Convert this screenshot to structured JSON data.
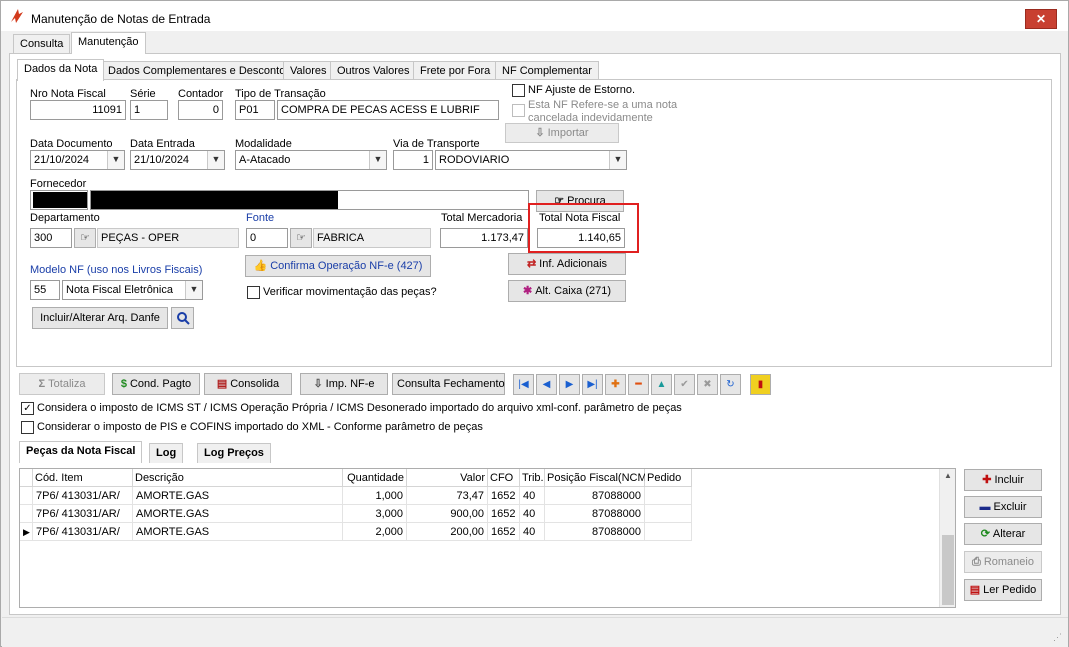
{
  "window": {
    "title": "Manutenção de Notas de Entrada",
    "close": "✕"
  },
  "main_tabs": [
    {
      "label": "Consulta"
    },
    {
      "label": "Manutenção"
    }
  ],
  "sub_tabs": [
    {
      "label": "Dados da Nota"
    },
    {
      "label": "Dados Complementares e Desconto"
    },
    {
      "label": "Valores"
    },
    {
      "label": "Outros Valores"
    },
    {
      "label": "Frete por Fora"
    },
    {
      "label": "NF Complementar"
    }
  ],
  "form": {
    "nro_nota_label": "Nro Nota Fiscal",
    "nro_nota": "11091",
    "serie_label": "Série",
    "serie": "1",
    "contador_label": "Contador",
    "contador": "0",
    "tipo_label": "Tipo de Transação",
    "tipo_code": "P01",
    "tipo_desc": "COMPRA DE PECAS ACESS E LUBRIF",
    "ajuste_label": "NF Ajuste  de Estorno.",
    "refere_label1": "Esta NF Refere-se a uma nota",
    "refere_label2": "cancelada indevidamente",
    "importar_label": "Importar",
    "data_doc_label": "Data Documento",
    "data_doc": "21/10/2024",
    "data_ent_label": "Data Entrada",
    "data_ent": "21/10/2024",
    "modalidade_label": "Modalidade",
    "modalidade": "A-Atacado",
    "via_label": "Via de Transporte",
    "via_code": "1",
    "via_desc": "RODOVIARIO",
    "fornecedor_label": "Fornecedor",
    "procura_label": "Procura",
    "depto_label": "Departamento",
    "depto_code": "300",
    "depto_desc": "PEÇAS - OPER",
    "fonte_label": "Fonte",
    "fonte_code": "0",
    "fonte_desc": "FABRICA",
    "total_merc_label": "Total Mercadoria",
    "total_merc": "1.173,47",
    "total_nf_label": "Total Nota Fiscal",
    "total_nf": "1.140,65",
    "modelo_label": "Modelo NF (uso nos Livros Fiscais)",
    "modelo_code": "55",
    "modelo_desc": "Nota Fiscal Eletrônica",
    "confirma_label": "Confirma Operação NF-e (427)",
    "verificar_label": "Verificar movimentação das peças?",
    "inf_adicionais_label": "Inf. Adicionais",
    "alt_caixa_label": "Alt. Caixa (271)",
    "danfe_label": "Incluir/Alterar Arq. Danfe"
  },
  "toolbar": {
    "totaliza": "Totaliza",
    "cond_pagto": "Cond. Pagto",
    "consolida": "Consolida",
    "imp_nfe": "Imp.  NF-e",
    "consulta_fech": "Consulta Fechamento"
  },
  "checks": {
    "icms_label": "Considera o imposto de ICMS ST / ICMS Operação Própria / ICMS Desonerado importado do arquivo xml-conf. parâmetro de peças",
    "pis_label": "Considerar o imposto de PIS e COFINS importado do XML - Conforme parâmetro de peças"
  },
  "bottom_tabs": [
    {
      "label": "Peças da Nota Fiscal"
    },
    {
      "label": "Log"
    },
    {
      "label": "Log Preços"
    }
  ],
  "grid": {
    "headers": [
      "Cód. Item",
      "Descrição",
      "Quantidade",
      "Valor",
      "CFO",
      "Trib.",
      "Posição Fiscal(NCM)",
      "Pedido"
    ],
    "rows": [
      {
        "cod": "7P6/  413031/AR/",
        "desc": "AMORTE.GAS",
        "qtd": "1,000",
        "valor": "73,47",
        "cfo": "1652",
        "trib": "40",
        "ncm": "87088000",
        "pedido": ""
      },
      {
        "cod": "7P6/  413031/AR/",
        "desc": "AMORTE.GAS",
        "qtd": "3,000",
        "valor": "900,00",
        "cfo": "1652",
        "trib": "40",
        "ncm": "87088000",
        "pedido": ""
      },
      {
        "cod": "7P6/  413031/AR/",
        "desc": "AMORTE.GAS",
        "qtd": "2,000",
        "valor": "200,00",
        "cfo": "1652",
        "trib": "40",
        "ncm": "87088000",
        "pedido": ""
      }
    ]
  },
  "side_buttons": {
    "incluir": "Incluir",
    "excluir": "Excluir",
    "alterar": "Alterar",
    "romaneio": "Romaneio",
    "ler_pedido": "Ler Pedido"
  },
  "colors": {
    "accent_blue": "#1a3ea8",
    "highlight_red": "#e02020"
  }
}
